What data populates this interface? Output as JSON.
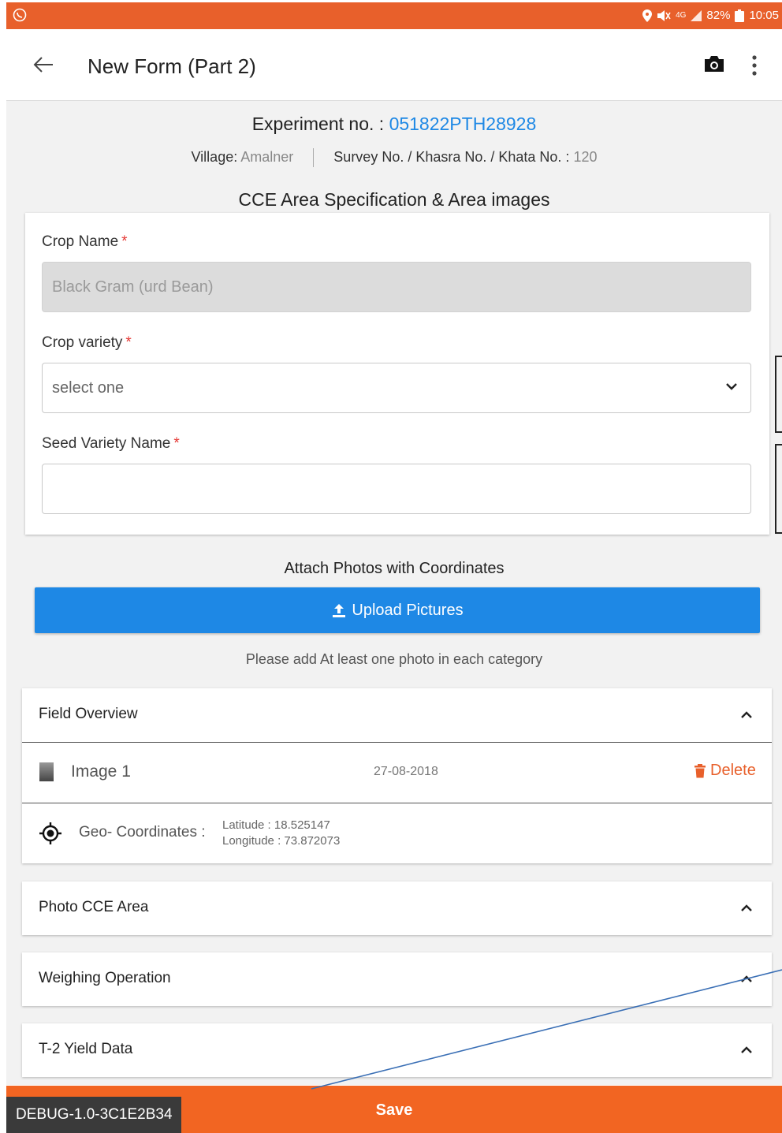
{
  "status_bar": {
    "battery": "82%",
    "time": "10:05",
    "network": "4G"
  },
  "app_bar": {
    "title": "New Form (Part 2)"
  },
  "experiment": {
    "label": "Experiment no. :",
    "value": "051822PTH28928",
    "village_label": "Village:",
    "village_value": "Amalner",
    "survey_label": "Survey No. / Khasra No. / Khata No. :",
    "survey_value": "120"
  },
  "section_heading": "CCE Area Specification & Area images",
  "form": {
    "crop_name_label": "Crop Name",
    "crop_name_value": "Black Gram (urd Bean)",
    "crop_variety_label": "Crop variety",
    "crop_variety_value": "select one",
    "seed_variety_label": "Seed Variety Name",
    "seed_variety_value": "",
    "required_mark": "*"
  },
  "attach": {
    "heading": "Attach Photos with Coordinates",
    "upload_label": "Upload Pictures",
    "hint": "Please add At least one photo in each category"
  },
  "panels": {
    "field_overview": {
      "title": "Field Overview",
      "image_label": "Image 1",
      "image_date": "27-08-2018",
      "delete_label": "Delete",
      "geo_label": "Geo- Coordinates :",
      "latitude": "Latitude : 18.525147",
      "longitude": "Longitude : 73.872073"
    },
    "photo_cce_area": {
      "title": "Photo CCE Area"
    },
    "weighing_operation": {
      "title": "Weighing Operation"
    },
    "t2_yield_data": {
      "title": "T-2 Yield Data"
    }
  },
  "bottom": {
    "debug_label": "DEBUG-1.0-3C1E2B34",
    "save_label": "Save"
  },
  "colors": {
    "primary_orange": "#f26522",
    "accent_blue": "#1e88e5",
    "required_red": "#e53935"
  }
}
